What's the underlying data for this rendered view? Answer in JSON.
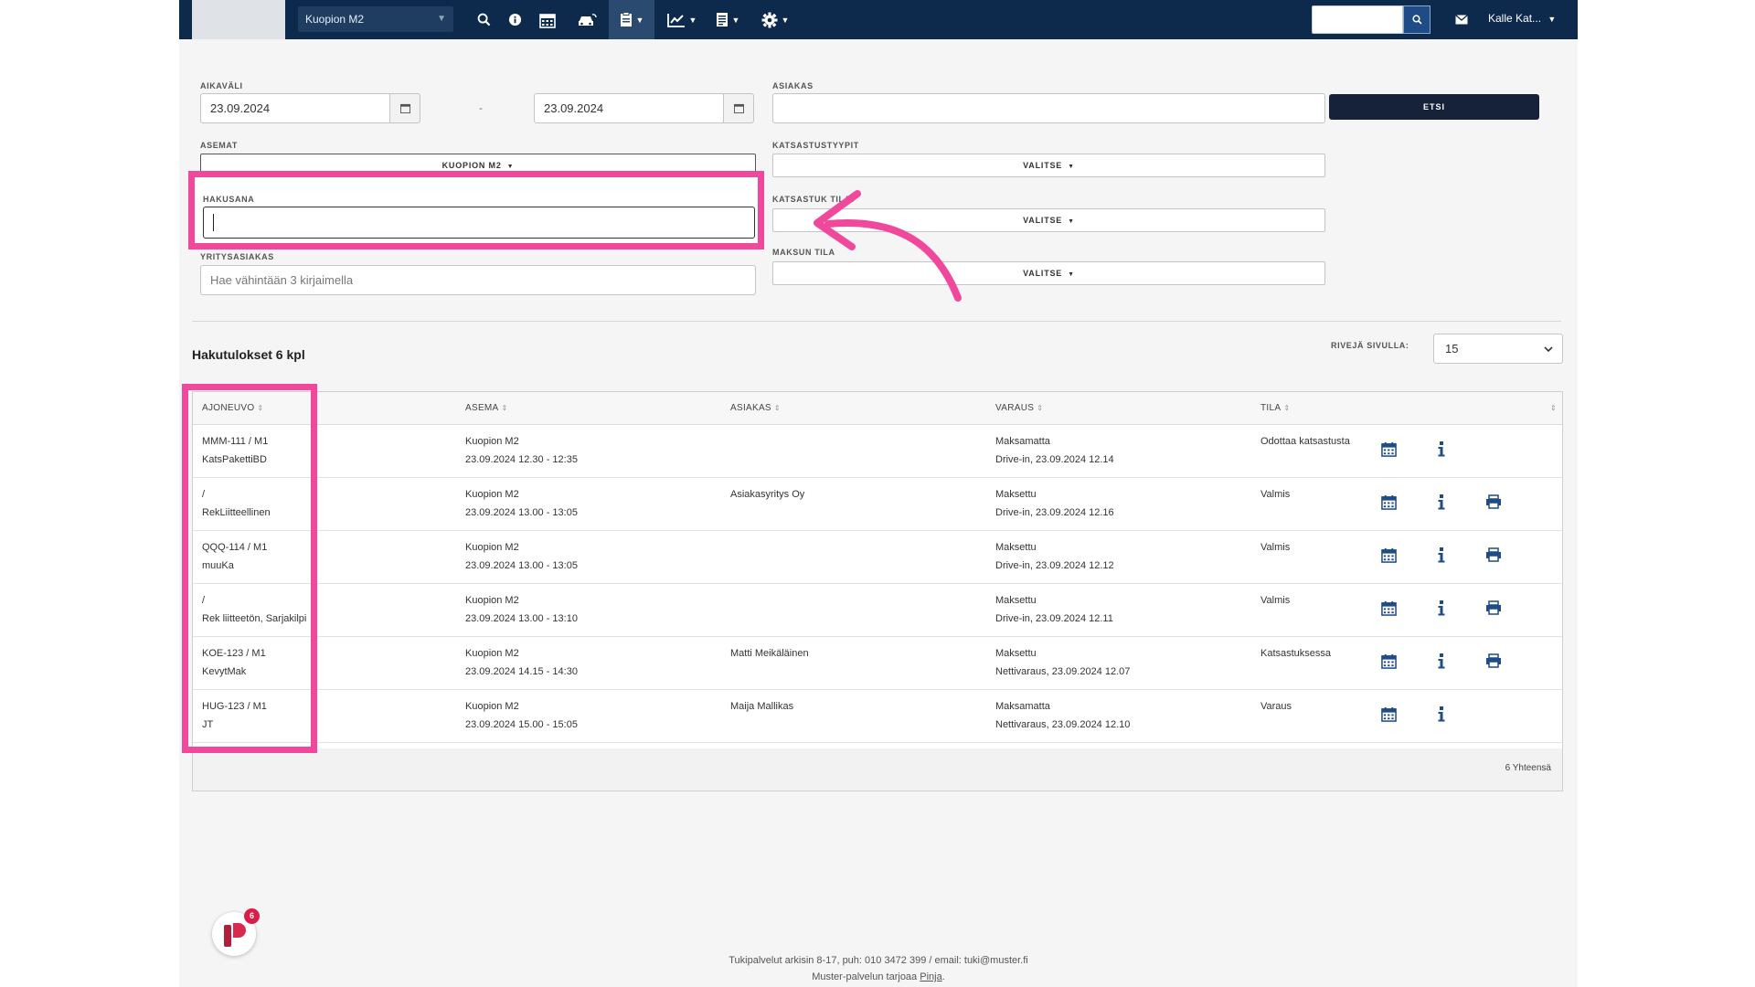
{
  "navbar": {
    "station": "Kuopion M2",
    "user": "Kalle Kat...",
    "icons": [
      "search-icon",
      "info-icon",
      "calendar-icon",
      "car-swap-icon",
      "clipboard-icon",
      "chart-icon",
      "document-icon",
      "gear-icon",
      "mail-icon"
    ]
  },
  "filters": {
    "aikavali_label": "AIKAVÄLI",
    "date_from": "23.09.2024",
    "date_to": "23.09.2024",
    "dash": "-",
    "asiakas_label": "ASIAKAS",
    "etsi_label": "ETSI",
    "asemat_label": "ASEMAT",
    "asemat_value": "KUOPION M2",
    "katsastustyypit_label": "KATSASTUSTYYPIT",
    "katsastustyypit_value": "VALITSE",
    "hakusana_label": "HAKUSANA",
    "katsastusten_tilat_label": "KATSASTUK   TILAT",
    "katsastusten_tilat_value": "VALITSE",
    "yritysasiakas_label": "YRITYSASIAKAS",
    "yritysasiakas_placeholder": "Hae vähintään 3 kirjaimella",
    "maksun_tila_label": "MAKSUN TILA",
    "maksun_tila_value": "VALITSE"
  },
  "results": {
    "title": "Hakutulokset 6 kpl",
    "rows_per_page_label": "RIVEJÄ SIVULLA:",
    "rows_per_page": "15",
    "columns": [
      "AJONEUVO",
      "ASEMA",
      "ASIAKAS",
      "VARAUS",
      "TILA"
    ],
    "rows": [
      {
        "vehicle_1": "MMM-111 / M1",
        "vehicle_2": "KatsPakettiBD",
        "station": "Kuopion M2",
        "time": "23.09.2024 12.30 - 12:35",
        "customer": "",
        "payment": "Maksamatta",
        "booking": "Drive-in, 23.09.2024 12.14",
        "status": "Odottaa katsastusta",
        "printable": false
      },
      {
        "vehicle_1": "/",
        "vehicle_2": "RekLiitteellinen",
        "station": "Kuopion M2",
        "time": "23.09.2024 13.00 - 13:05",
        "customer": "Asiakasyritys Oy",
        "payment": "Maksettu",
        "booking": "Drive-in, 23.09.2024 12.16",
        "status": "Valmis",
        "printable": true
      },
      {
        "vehicle_1": "QQQ-114 / M1",
        "vehicle_2": "muuKa",
        "station": "Kuopion M2",
        "time": "23.09.2024 13.00 - 13:05",
        "customer": "",
        "payment": "Maksettu",
        "booking": "Drive-in, 23.09.2024 12.12",
        "status": "Valmis",
        "printable": true
      },
      {
        "vehicle_1": "/",
        "vehicle_2": "Rek liitteetön, Sarjakilpi",
        "station": "Kuopion M2",
        "time": "23.09.2024 13.00 - 13:10",
        "customer": "",
        "payment": "Maksettu",
        "booking": "Drive-in, 23.09.2024 12.11",
        "status": "Valmis",
        "printable": true
      },
      {
        "vehicle_1": "KOE-123 / M1",
        "vehicle_2": "KevytMak",
        "station": "Kuopion M2",
        "time": "23.09.2024 14.15 - 14:30",
        "customer": "Matti Meikäläinen",
        "payment": "Maksettu",
        "booking": "Nettivaraus, 23.09.2024 12.07",
        "status": "Katsastuksessa",
        "printable": true
      },
      {
        "vehicle_1": "HUG-123 / M1",
        "vehicle_2": "JT",
        "station": "Kuopion M2",
        "time": "23.09.2024 15.00 - 15:05",
        "customer": "Maija Mallikas",
        "payment": "Maksamatta",
        "booking": "Nettivaraus, 23.09.2024 12.10",
        "status": "Varaus",
        "printable": false
      }
    ],
    "total": "6 Yhteensä"
  },
  "footer": {
    "support": "Tukipalvelut arkisin 8-17, puh: 010 3472 399 / email: tuki@muster.fi",
    "provided_prefix": "Muster-palvelun tarjoaa",
    "provided_link": "Pinja",
    "provided_suffix": ".",
    "badge_count": "6"
  },
  "colors": {
    "navbar": "#0d2a4c",
    "highlight": "#f0489b",
    "icon_blue": "#1f4b86"
  }
}
